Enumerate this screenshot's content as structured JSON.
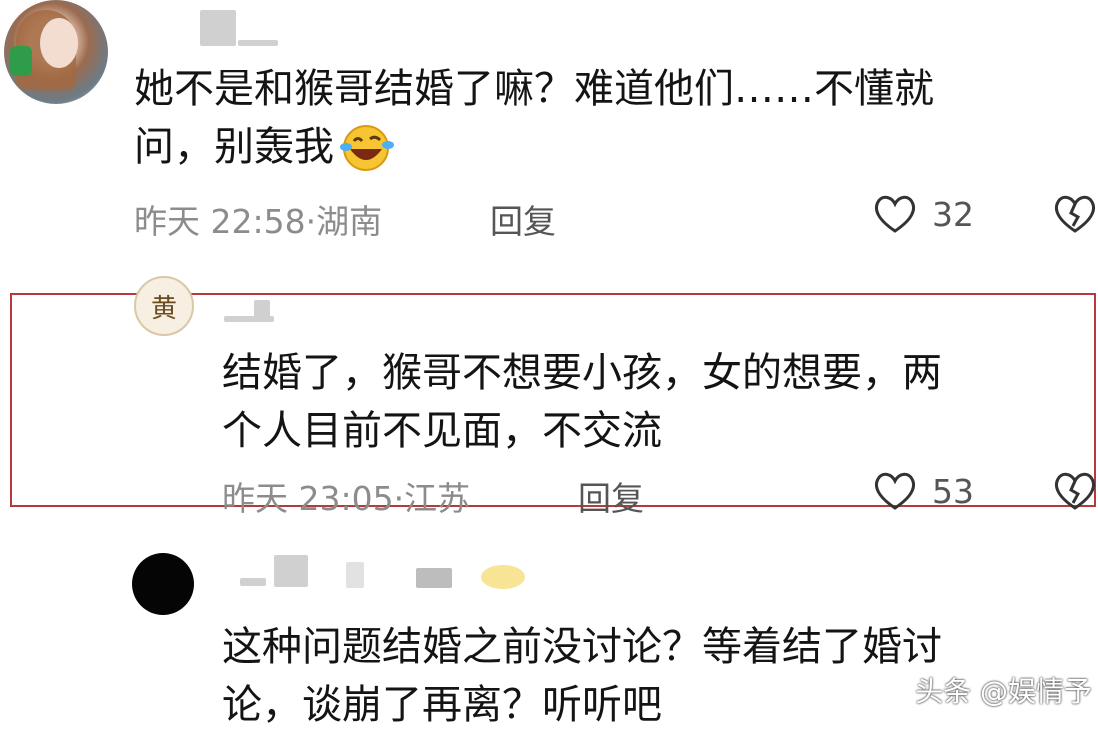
{
  "comments": [
    {
      "text_line1": "她不是和猴哥结婚了嘛？难道他们……不懂就",
      "text_line2": "问，别轰我",
      "emoji": "laughing-crying-emoji",
      "timestamp": "昨天 22:58·湖南",
      "reply_label": "回复",
      "like_count": "32"
    },
    {
      "avatar_char": "黄",
      "text_line1": "结婚了，猴哥不想要小孩，女的想要，两",
      "text_line2": "个人目前不见面，不交流",
      "timestamp": "昨天 23:05·江苏",
      "reply_label": "回复",
      "like_count": "53"
    },
    {
      "text_line1": "这种问题结婚之前没讨论？等着结了婚讨",
      "text_line2": "论，谈崩了再离？听听吧"
    }
  ],
  "watermark": "头条 @娱情予",
  "colors": {
    "highlight_border": "#b63a3a",
    "meta_text": "#8c8c8c"
  }
}
